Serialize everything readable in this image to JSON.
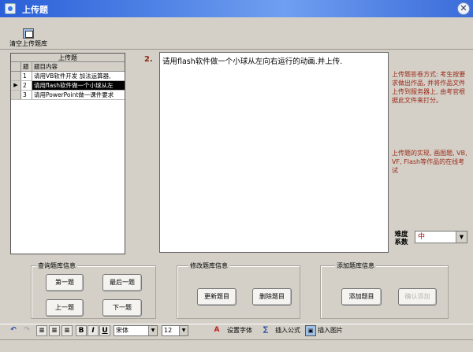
{
  "window": {
    "title": "上传题",
    "close": "✕"
  },
  "toolbar": {
    "clear_label": "清空上传题库"
  },
  "grid": {
    "title": "上传题",
    "headers": [
      "题号",
      "题目内容"
    ],
    "rows": [
      {
        "num": "1",
        "text": "请用VB软件开发 加法运算器,",
        "selected": false
      },
      {
        "num": "2",
        "text": "请用flash软件做一个小球从左",
        "selected": true
      },
      {
        "num": "3",
        "text": "请用PowerPoint做一课件要求",
        "selected": false
      }
    ],
    "row_marker": "▶"
  },
  "question": {
    "number": "2.",
    "text": "请用flash软件做一个小球从左向右运行的动画.并上传."
  },
  "info": {
    "method": "上传题答卷方式: 考生按要求做出作品, 并将作品文件上传到服务器上, 由考官根据此文件来打分。",
    "purpose": "上传题的实现, 画图题, VB, VF, Flash等作品的在线考试"
  },
  "difficulty": {
    "label": "难度系数",
    "value": "中"
  },
  "query_group": {
    "title": "查询题库信息",
    "first": "第一题",
    "last": "最后一题",
    "prev": "上一题",
    "next": "下一题"
  },
  "modify_group": {
    "title": "修改题库信息",
    "update": "更新题目",
    "delete": "删除题目"
  },
  "add_group": {
    "title": "添加题库信息",
    "add": "添加题目",
    "confirm": "确认添加"
  },
  "editbar": {
    "undo": "↶",
    "redo": "↷",
    "bold": "B",
    "italic": "I",
    "underline": "U",
    "font": "宋体",
    "size": "12",
    "set_font": "设置字体",
    "insert_formula": "插入公式",
    "insert_image": "插入图片"
  }
}
